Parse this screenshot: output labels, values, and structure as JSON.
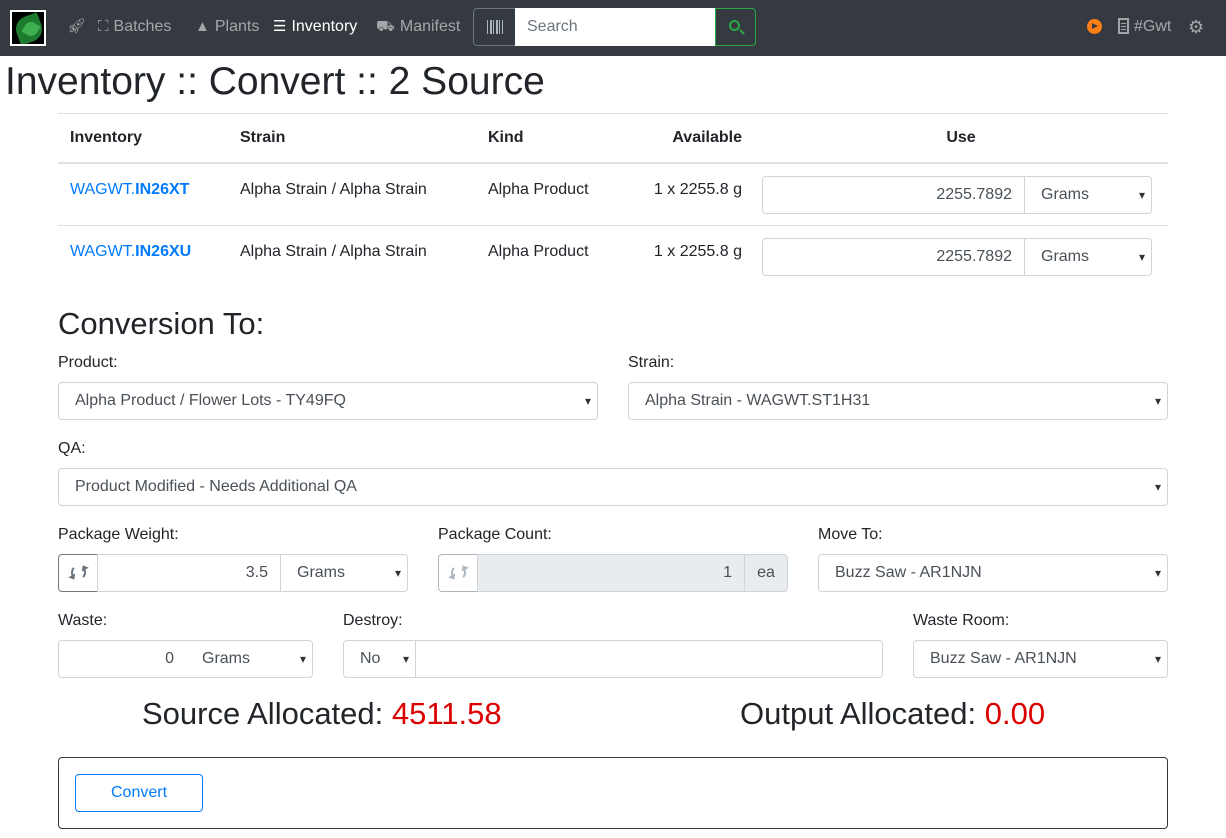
{
  "nav": {
    "items": [
      {
        "label": "",
        "icon": "rocket-icon"
      },
      {
        "label": "Batches",
        "icon": "crop-frame-icon"
      },
      {
        "label": "Plants",
        "icon": "tree-icon"
      },
      {
        "label": "Inventory",
        "icon": "list-icon",
        "active": true
      },
      {
        "label": "Manifest",
        "icon": "truck-icon"
      }
    ],
    "search_placeholder": "Search",
    "org_label": "#Gwt"
  },
  "page": {
    "title": "Inventory :: Convert :: 2 Source"
  },
  "source_table": {
    "headers": [
      "Inventory",
      "Strain",
      "Kind",
      "Available",
      "Use"
    ],
    "rows": [
      {
        "inventory_prefix": "WAGWT.",
        "inventory_id": "IN26XT",
        "strain": "Alpha Strain / Alpha Strain",
        "kind": "Alpha Product",
        "available": "1 x 2255.8 g",
        "use": "2255.7892",
        "unit": "Grams"
      },
      {
        "inventory_prefix": "WAGWT.",
        "inventory_id": "IN26XU",
        "strain": "Alpha Strain / Alpha Strain",
        "kind": "Alpha Product",
        "available": "1 x 2255.8 g",
        "use": "2255.7892",
        "unit": "Grams"
      }
    ]
  },
  "conversion": {
    "title": "Conversion To:",
    "product_label": "Product:",
    "product_value": "Alpha Product / Flower Lots - TY49FQ",
    "strain_label": "Strain:",
    "strain_value": "Alpha Strain - WAGWT.ST1H31",
    "qa_label": "QA:",
    "qa_value": "Product Modified - Needs Additional QA",
    "package_weight_label": "Package Weight:",
    "package_weight_value": "3.5",
    "package_weight_unit": "Grams",
    "package_count_label": "Package Count:",
    "package_count_value": "1",
    "package_count_unit": "ea",
    "move_to_label": "Move To:",
    "move_to_value": "Buzz Saw - AR1NJN",
    "waste_label": "Waste:",
    "waste_value": "0",
    "waste_unit": "Grams",
    "destroy_label": "Destroy:",
    "destroy_value": "No",
    "destroy_note": "",
    "waste_room_label": "Waste Room:",
    "waste_room_value": "Buzz Saw - AR1NJN"
  },
  "totals": {
    "source_label": "Source Allocated: ",
    "source_value": "4511.58",
    "output_label": "Output Allocated: ",
    "output_value": "0.00"
  },
  "actions": {
    "convert_label": "Convert"
  },
  "colors": {
    "navbar_bg": "#343a40",
    "link": "#007bff",
    "alert_red": "#dc0000",
    "search_green": "#28a745",
    "play_orange": "#fd7e14"
  }
}
